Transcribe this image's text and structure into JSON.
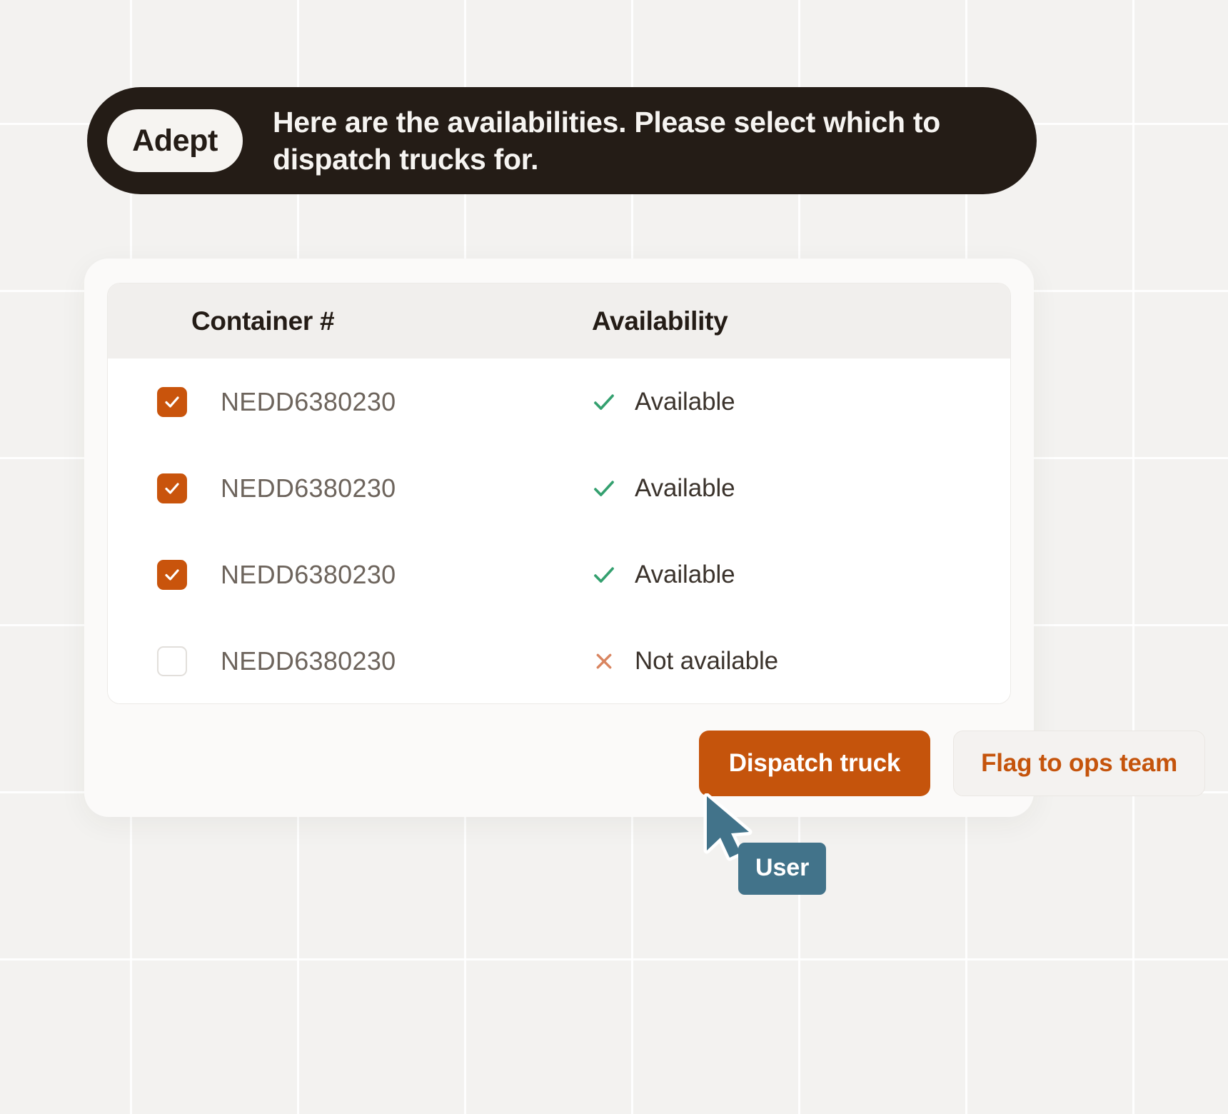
{
  "theme": {
    "background": "#f3f2f0",
    "grid_line": "#ffffff",
    "bubble_bg": "#241c16",
    "bubble_text": "#f6f4f1",
    "accent_orange": "#c5540c",
    "checkbox_orange": "#c9540c",
    "available_green": "#34a06f",
    "not_available_red": "#d98560",
    "cursor_teal": "#42738a",
    "card_bg": "#fbfaf9",
    "table_header_bg": "#f1efed"
  },
  "chat": {
    "agent_label": "Adept",
    "message": "Here are the availabilities. Please select which to dispatch trucks for."
  },
  "table": {
    "columns": [
      "Container #",
      "Availability"
    ],
    "rows": [
      {
        "checked": true,
        "container": "NEDD6380230",
        "status": "Available",
        "status_icon": "check-icon"
      },
      {
        "checked": true,
        "container": "NEDD6380230",
        "status": "Available",
        "status_icon": "check-icon"
      },
      {
        "checked": true,
        "container": "NEDD6380230",
        "status": "Available",
        "status_icon": "check-icon"
      },
      {
        "checked": false,
        "container": "NEDD6380230",
        "status": "Not available",
        "status_icon": "cross-icon"
      }
    ]
  },
  "actions": {
    "primary_label": "Dispatch truck",
    "secondary_label": "Flag to ops team"
  },
  "cursor": {
    "label": "User"
  }
}
